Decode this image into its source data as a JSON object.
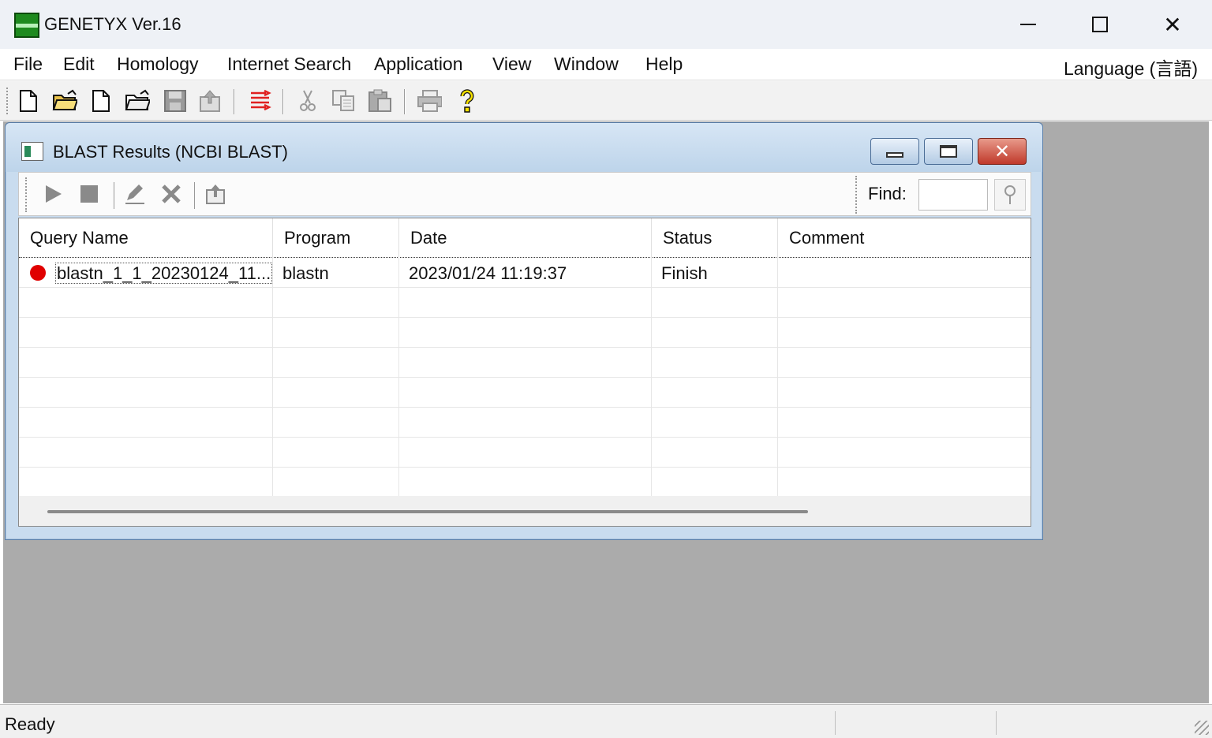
{
  "window": {
    "title": "GENETYX Ver.16",
    "minimize_glyph": "",
    "close_glyph": "✕"
  },
  "menu": {
    "items": [
      "File",
      "Edit",
      "Homology",
      "Internet Search",
      "Application",
      "View",
      "Window",
      "Help"
    ],
    "language": "Language (言語)"
  },
  "toolbar": {
    "icons": [
      "new-file-icon",
      "open-folder-icon",
      "new-sequence-icon",
      "open-sequence-icon",
      "save-icon",
      "export-icon",
      "align-icon",
      "cut-icon",
      "copy-icon",
      "paste-icon",
      "print-icon",
      "help-icon"
    ]
  },
  "child": {
    "title": "BLAST Results (NCBI BLAST)",
    "close_glyph": "✕",
    "find_label": "Find:",
    "find_value": "",
    "columns": [
      "Query Name",
      "Program",
      "Date",
      "Status",
      "Comment"
    ],
    "rows": [
      {
        "status_color": "#e00000",
        "query_name": "blastn_1_1_20230124_11...",
        "program": "blastn",
        "date": "2023/01/24 11:19:37",
        "status": "Finish",
        "comment": ""
      }
    ]
  },
  "status": {
    "text": "Ready"
  }
}
